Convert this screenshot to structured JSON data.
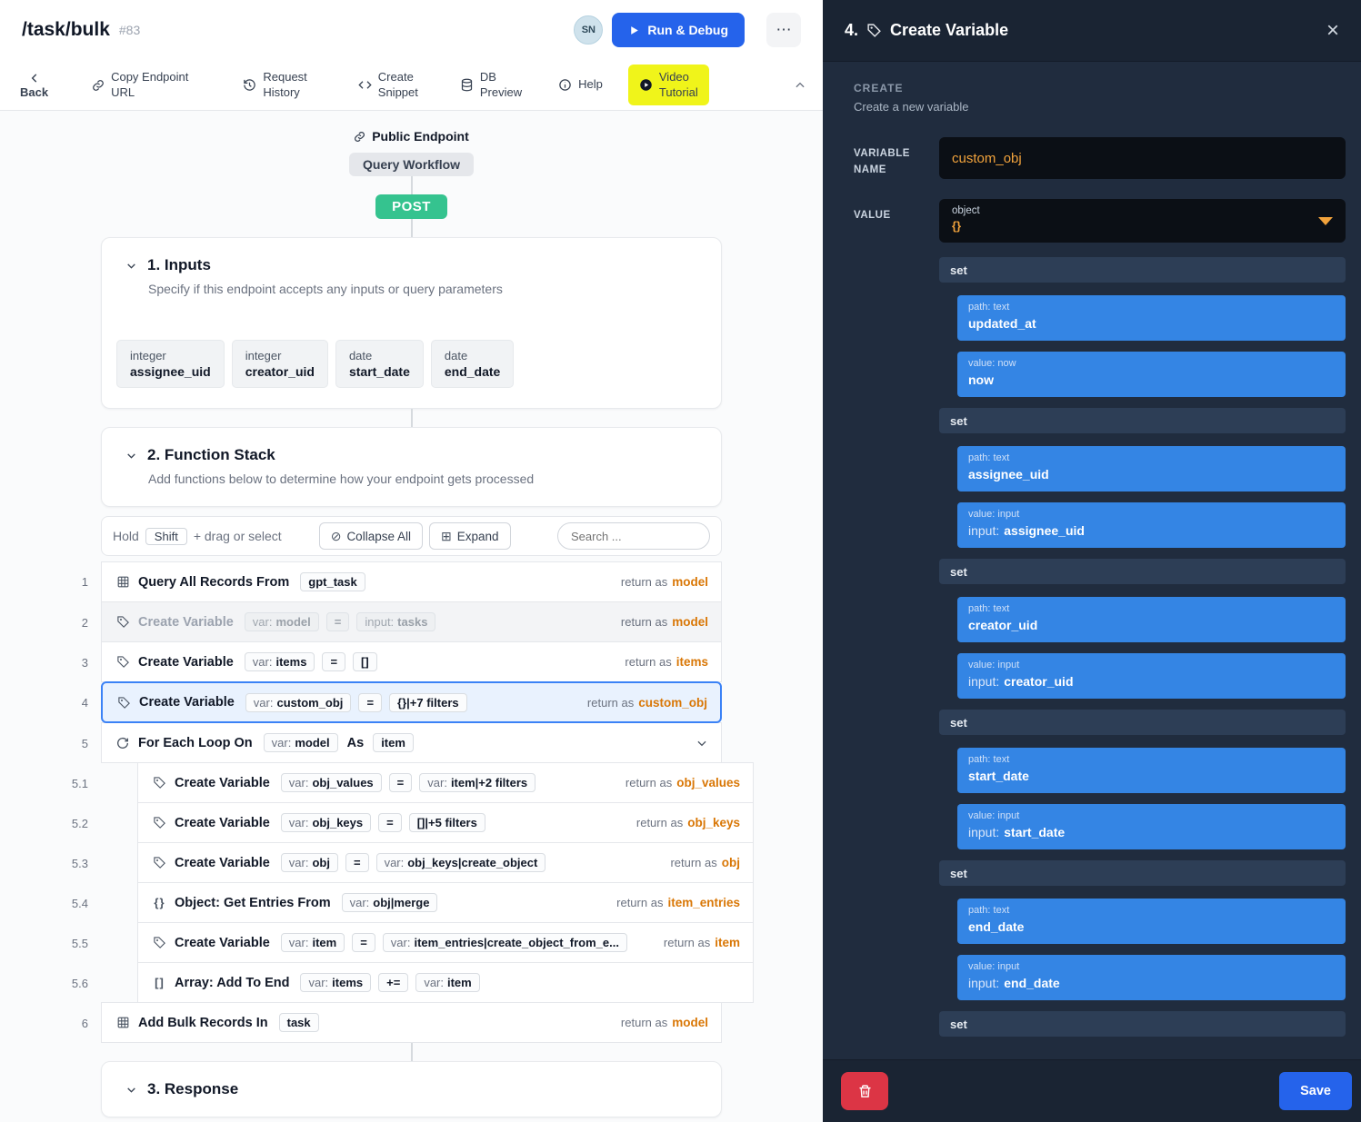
{
  "colors": {
    "accent_blue": "#2563eb",
    "block_blue": "#3485e4",
    "return_orange": "#d97706",
    "panel_orange": "#f2a33c",
    "method_green": "#35c38f",
    "highlight_yellow": "#f0f41a",
    "danger_red": "#dc3545"
  },
  "app": {
    "title": "/task/bulk",
    "endpoint_id": "#83",
    "avatar_initials": "SN",
    "run_button": "Run & Debug",
    "more_button": "⋯"
  },
  "toolbar": {
    "back": "Back",
    "copy_endpoint": {
      "l1": "Copy Endpoint",
      "l2": "URL"
    },
    "request_history": {
      "l1": "Request",
      "l2": "History"
    },
    "create_snippet": {
      "l1": "Create",
      "l2": "Snippet"
    },
    "db_preview": {
      "l1": "DB",
      "l2": "Preview"
    },
    "help": "Help",
    "video_tutorial": {
      "l1": "Video",
      "l2": "Tutorial"
    }
  },
  "canvas": {
    "public_endpoint": "Public Endpoint",
    "workflow_pill": "Query Workflow",
    "method": "POST",
    "inputs": {
      "title": "1. Inputs",
      "description": "Specify if this endpoint accepts any inputs or query parameters",
      "fields": [
        {
          "type": "integer",
          "name": "assignee_uid"
        },
        {
          "type": "integer",
          "name": "creator_uid"
        },
        {
          "type": "date",
          "name": "start_date"
        },
        {
          "type": "date",
          "name": "end_date"
        }
      ]
    },
    "stack": {
      "title": "2. Function Stack",
      "description": "Add functions below to determine how your endpoint gets processed",
      "hint_pre": "Hold",
      "hint_key": "Shift",
      "hint_post": "+ drag or select",
      "collapse_all": "Collapse All",
      "expand": "Expand",
      "search_placeholder": "Search ...",
      "return_label": "return as",
      "rows": [
        {
          "num": "1",
          "title": "Query All Records From",
          "chips": [
            {
              "v": "gpt_task"
            }
          ],
          "ret": "model"
        },
        {
          "num": "2",
          "title": "Create Variable",
          "chips": [
            {
              "p": "var:",
              "v": "model"
            },
            {
              "v": "="
            },
            {
              "p": "input:",
              "v": "tasks"
            }
          ],
          "ret": "model"
        },
        {
          "num": "3",
          "title": "Create Variable",
          "chips": [
            {
              "p": "var:",
              "v": "items"
            },
            {
              "v": "="
            },
            {
              "v": "[]"
            }
          ],
          "ret": "items"
        },
        {
          "num": "4",
          "title": "Create Variable",
          "chips": [
            {
              "p": "var:",
              "v": "custom_obj"
            },
            {
              "v": "="
            },
            {
              "v": "{}|+7 filters"
            }
          ],
          "ret": "custom_obj"
        },
        {
          "num": "5",
          "title": "For Each Loop On",
          "chips": [
            {
              "p": "var:",
              "v": "model"
            }
          ],
          "as_label": "As",
          "as_value": "item"
        },
        {
          "num": "5.1",
          "title": "Create Variable",
          "chips": [
            {
              "p": "var:",
              "v": "obj_values"
            },
            {
              "v": "="
            },
            {
              "p": "var:",
              "v": "item|+2 filters"
            }
          ],
          "ret": "obj_values"
        },
        {
          "num": "5.2",
          "title": "Create Variable",
          "chips": [
            {
              "p": "var:",
              "v": "obj_keys"
            },
            {
              "v": "="
            },
            {
              "v": "[]|+5 filters"
            }
          ],
          "ret": "obj_keys"
        },
        {
          "num": "5.3",
          "title": "Create Variable",
          "chips": [
            {
              "p": "var:",
              "v": "obj"
            },
            {
              "v": "="
            },
            {
              "p": "var:",
              "v": "obj_keys|create_object"
            }
          ],
          "ret": "obj"
        },
        {
          "num": "5.4",
          "title": "Object: Get Entries From",
          "chips": [
            {
              "p": "var:",
              "v": "obj|merge"
            }
          ],
          "ret": "item_entries"
        },
        {
          "num": "5.5",
          "title": "Create Variable",
          "chips": [
            {
              "p": "var:",
              "v": "item"
            },
            {
              "v": "="
            },
            {
              "p": "var:",
              "v": "item_entries|create_object_from_e..."
            }
          ],
          "ret": "item"
        },
        {
          "num": "5.6",
          "title": "Array: Add To End",
          "chips": [
            {
              "p": "var:",
              "v": "items"
            },
            {
              "v": "+="
            },
            {
              "p": "var:",
              "v": "item"
            }
          ]
        },
        {
          "num": "6",
          "title": "Add Bulk Records In",
          "chips": [
            {
              "v": "task"
            }
          ],
          "ret": "model"
        }
      ]
    },
    "response_title": "3. Response"
  },
  "panel": {
    "step": "4.",
    "title": "Create Variable",
    "section": "CREATE",
    "section_desc": "Create a new variable",
    "var_name_label": "VARIABLE NAME",
    "var_name_value": "custom_obj",
    "value_label": "VALUE",
    "value_type": "object",
    "value_preview": "{}",
    "set_label": "set",
    "groups": [
      {
        "path_label": "path: text",
        "path_value": "updated_at",
        "value_label": "value: now",
        "value_pre": "",
        "value": "now"
      },
      {
        "path_label": "path: text",
        "path_value": "assignee_uid",
        "value_label": "value: input",
        "value_pre": "input:",
        "value": "assignee_uid"
      },
      {
        "path_label": "path: text",
        "path_value": "creator_uid",
        "value_label": "value: input",
        "value_pre": "input:",
        "value": "creator_uid"
      },
      {
        "path_label": "path: text",
        "path_value": "start_date",
        "value_label": "value: input",
        "value_pre": "input:",
        "value": "start_date"
      },
      {
        "path_label": "path: text",
        "path_value": "end_date",
        "value_label": "value: input",
        "value_pre": "input:",
        "value": "end_date"
      }
    ],
    "save": "Save"
  }
}
